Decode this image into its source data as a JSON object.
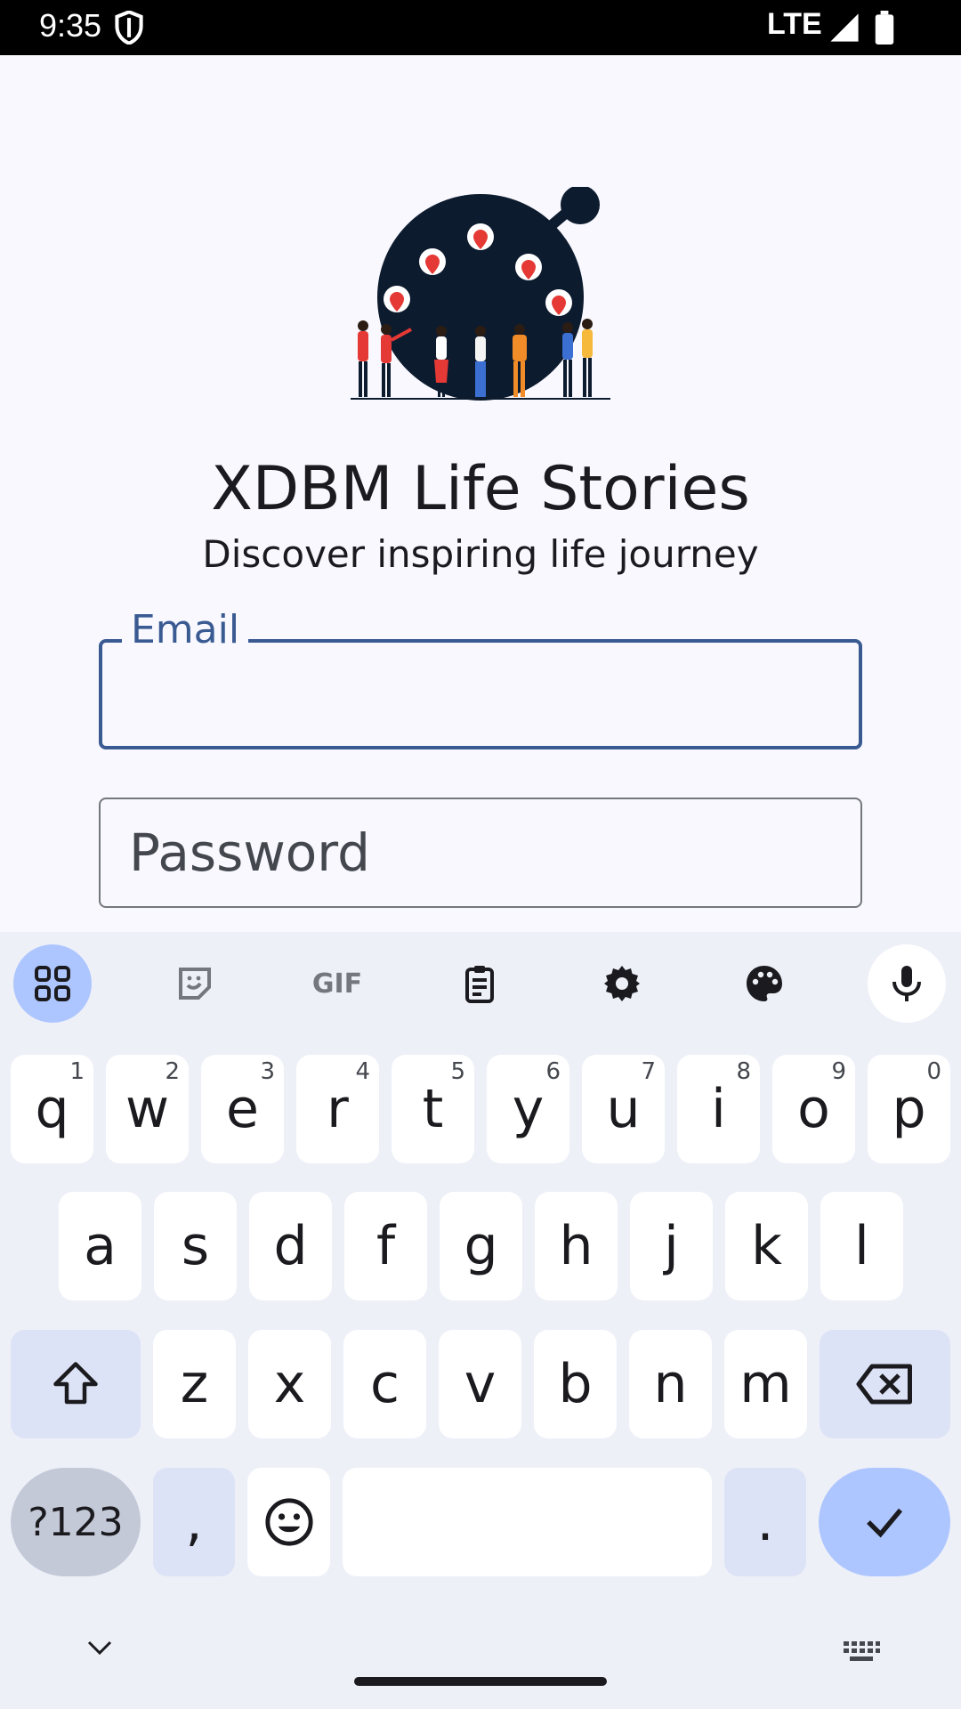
{
  "status_bar": {
    "time": "9:35",
    "network": "LTE",
    "icons": [
      "shield-icon",
      "signal-icon",
      "battery-icon"
    ]
  },
  "app": {
    "title": "XDBM Life Stories",
    "subtitle": "Discover inspiring life journey",
    "email": {
      "label": "Email",
      "value": ""
    },
    "password": {
      "placeholder": "Password",
      "value": ""
    },
    "colors": {
      "accent": "#3a5a92",
      "background": "#f8f8fe",
      "logo": "#0d1b2e",
      "pin": "#e53935"
    }
  },
  "keyboard": {
    "toolbar": [
      "apps-icon",
      "sticker-icon",
      "gif-icon",
      "clipboard-icon",
      "settings-icon",
      "palette-icon",
      "mic-icon"
    ],
    "gif_label": "GIF",
    "row1": [
      {
        "k": "q",
        "h": "1"
      },
      {
        "k": "w",
        "h": "2"
      },
      {
        "k": "e",
        "h": "3"
      },
      {
        "k": "r",
        "h": "4"
      },
      {
        "k": "t",
        "h": "5"
      },
      {
        "k": "y",
        "h": "6"
      },
      {
        "k": "u",
        "h": "7"
      },
      {
        "k": "i",
        "h": "8"
      },
      {
        "k": "o",
        "h": "9"
      },
      {
        "k": "p",
        "h": "0"
      }
    ],
    "row2": [
      "a",
      "s",
      "d",
      "f",
      "g",
      "h",
      "j",
      "k",
      "l"
    ],
    "row3": [
      "z",
      "x",
      "c",
      "v",
      "b",
      "n",
      "m"
    ],
    "symbols_label": "?123",
    "comma": ",",
    "period": ".",
    "colors": {
      "background": "#eef0f8",
      "key": "#ffffff",
      "function_key": "#dde3f6",
      "enter": "#aec6ff"
    }
  }
}
